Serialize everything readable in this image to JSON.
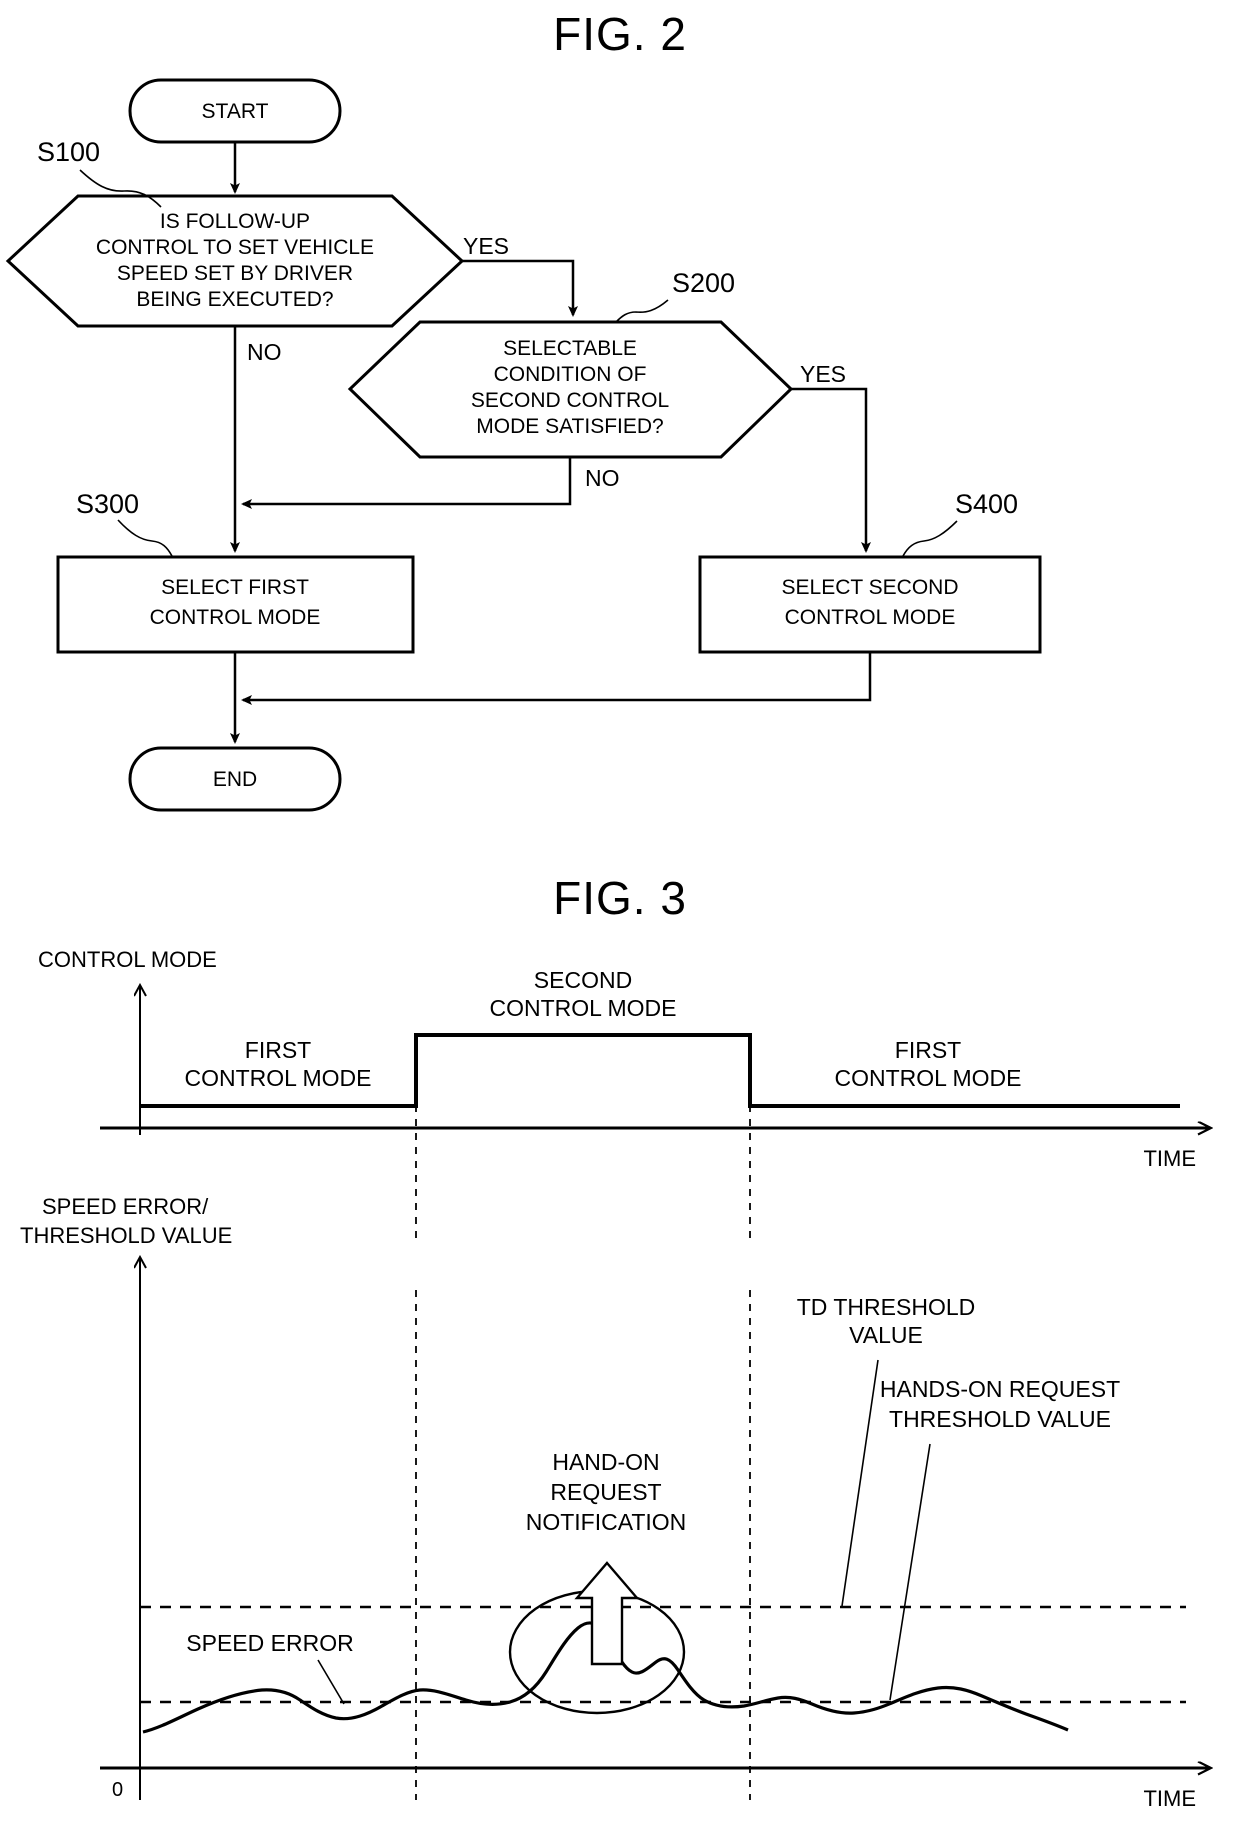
{
  "figure2": {
    "title": "FIG. 2",
    "nodes": {
      "start": "START",
      "end": "END",
      "s100_line1": "IS FOLLOW-UP",
      "s100_line2": "CONTROL TO SET VEHICLE",
      "s100_line3": "SPEED SET BY DRIVER",
      "s100_line4": "BEING EXECUTED?",
      "s200_line1": "SELECTABLE",
      "s200_line2": "CONDITION OF",
      "s200_line3": "SECOND CONTROL",
      "s200_line4": "MODE SATISFIED?",
      "s300_line1": "SELECT FIRST",
      "s300_line2": "CONTROL MODE",
      "s400_line1": "SELECT SECOND",
      "s400_line2": "CONTROL MODE"
    },
    "step_labels": {
      "s100": "S100",
      "s200": "S200",
      "s300": "S300",
      "s400": "S400"
    },
    "branches": {
      "s100_yes": "YES",
      "s100_no": "NO",
      "s200_yes": "YES",
      "s200_no": "NO"
    }
  },
  "figure3": {
    "title": "FIG. 3",
    "upper_chart": {
      "y_axis_label": "CONTROL MODE",
      "x_axis_label": "TIME",
      "segment_labels": [
        "FIRST\nCONTROL MODE",
        "SECOND\nCONTROL MODE",
        "FIRST\nCONTROL MODE"
      ],
      "label_first_left_l1": "FIRST",
      "label_first_left_l2": "CONTROL MODE",
      "label_second_l1": "SECOND",
      "label_second_l2": "CONTROL MODE",
      "label_first_right_l1": "FIRST",
      "label_first_right_l2": "CONTROL MODE"
    },
    "lower_chart": {
      "y_axis_label_l1": "SPEED ERROR/",
      "y_axis_label_l2": "THRESHOLD VALUE",
      "x_axis_label": "TIME",
      "origin_label": "0",
      "series_label": "SPEED ERROR",
      "annotation_l1": "HAND-ON",
      "annotation_l2": "REQUEST",
      "annotation_l3": "NOTIFICATION",
      "td_threshold_l1": "TD THRESHOLD",
      "td_threshold_l2": "VALUE",
      "hands_on_threshold_l1": "HANDS-ON REQUEST",
      "hands_on_threshold_l2": "THRESHOLD VALUE"
    }
  },
  "chart_data": [
    {
      "type": "line",
      "title": "CONTROL MODE vs TIME",
      "xlabel": "TIME",
      "ylabel": "CONTROL MODE",
      "grid": false,
      "legend": "none",
      "step_series": {
        "name": "control mode level",
        "x": [
          0.08,
          0.32,
          0.32,
          0.7,
          0.7,
          1.0
        ],
        "y": [
          1,
          1,
          2,
          2,
          1,
          1
        ],
        "levels": {
          "1": "FIRST CONTROL MODE",
          "2": "SECOND CONTROL MODE"
        }
      },
      "vertical_markers": [
        0.32,
        0.7
      ],
      "annotations": [
        {
          "text": "FIRST CONTROL MODE",
          "x": 0.19,
          "y": 1
        },
        {
          "text": "SECOND CONTROL MODE",
          "x": 0.51,
          "y": 2
        },
        {
          "text": "FIRST CONTROL MODE",
          "x": 0.85,
          "y": 1
        }
      ]
    },
    {
      "type": "line",
      "title": "SPEED ERROR / THRESHOLD VALUE vs TIME",
      "xlabel": "TIME",
      "ylabel": "SPEED ERROR/THRESHOLD VALUE",
      "ylim": [
        0,
        1
      ],
      "grid": false,
      "legend": "none",
      "threshold_lines": [
        {
          "name": "TD THRESHOLD VALUE",
          "value": 0.72,
          "style": "dashed"
        },
        {
          "name": "HANDS-ON REQUEST THRESHOLD VALUE",
          "value": 0.4,
          "style": "dashed"
        }
      ],
      "vertical_markers": [
        0.32,
        0.7
      ],
      "series": [
        {
          "name": "SPEED ERROR",
          "x": [
            0.0,
            0.04,
            0.09,
            0.14,
            0.18,
            0.22,
            0.26,
            0.31,
            0.35,
            0.4,
            0.44,
            0.47,
            0.5,
            0.53,
            0.56,
            0.58,
            0.61,
            0.64,
            0.67,
            0.7,
            0.74,
            0.78,
            0.82,
            0.86,
            0.9,
            0.94,
            0.98,
            1.0
          ],
          "y": [
            0.1,
            0.16,
            0.21,
            0.25,
            0.22,
            0.19,
            0.22,
            0.26,
            0.22,
            0.18,
            0.24,
            0.3,
            0.37,
            0.55,
            0.62,
            0.5,
            0.46,
            0.52,
            0.4,
            0.27,
            0.26,
            0.28,
            0.24,
            0.22,
            0.25,
            0.28,
            0.27,
            0.22
          ]
        }
      ],
      "annotations": [
        {
          "text": "SPEED ERROR",
          "x": 0.22,
          "y": 0.6
        },
        {
          "text": "HAND-ON REQUEST NOTIFICATION",
          "x": 0.52,
          "y": 0.92,
          "marker": "up-arrow"
        },
        {
          "text": "TD THRESHOLD VALUE",
          "x": 0.8,
          "y": 0.86
        },
        {
          "text": "HANDS-ON REQUEST THRESHOLD VALUE",
          "x": 0.84,
          "y": 0.6
        }
      ],
      "highlight_ellipse": {
        "cx": 0.55,
        "cy": 0.42,
        "rx": 0.1,
        "ry": 0.135
      }
    }
  ]
}
